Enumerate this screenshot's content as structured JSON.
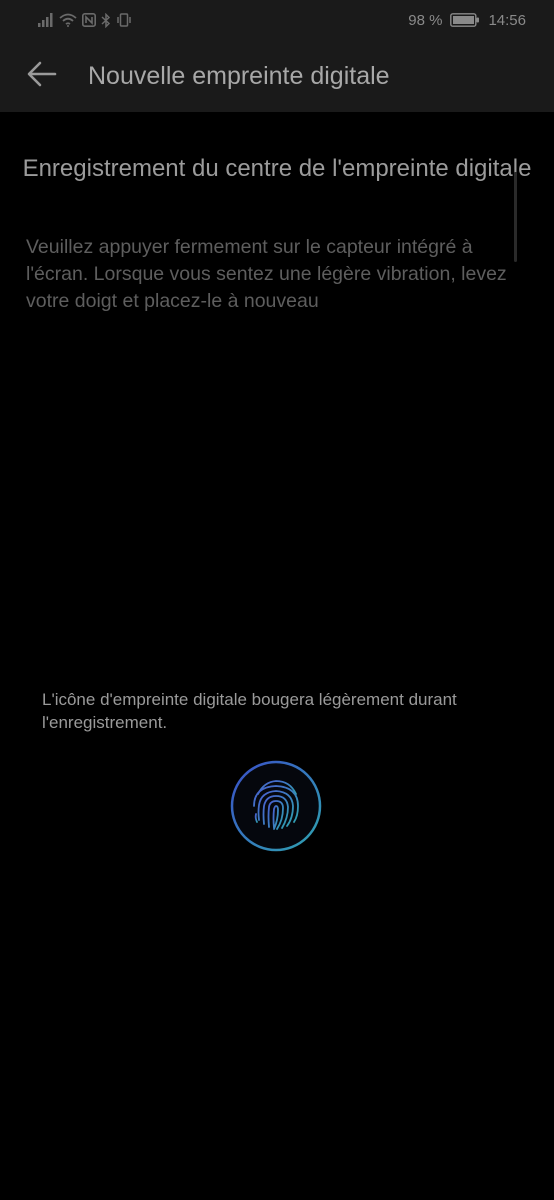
{
  "status_bar": {
    "battery_percent": "98 %",
    "time": "14:56",
    "icons": [
      "signal-icon",
      "wifi-icon",
      "nfc-icon",
      "bluetooth-icon",
      "vibrate-icon",
      "battery-icon"
    ]
  },
  "app_bar": {
    "back_icon": "arrow-left-icon",
    "title": "Nouvelle empreinte digitale"
  },
  "content": {
    "heading": "Enregistrement du centre de l'empreinte digitale",
    "instructions": "Veuillez appuyer fermement sur le capteur intégré à l'écran. Lorsque vous sentez une légère vibration, levez votre doigt et placez-le à nouveau",
    "hint": "L'icône d'empreinte digitale bougera légèrement durant l'enregistrement.",
    "sensor_icon": "fingerprint-icon"
  },
  "colors": {
    "background": "#000000",
    "bar_background": "#1a1a1a",
    "ring_gradient_start": "#3a4fc8",
    "ring_gradient_end": "#2fa3b0"
  }
}
